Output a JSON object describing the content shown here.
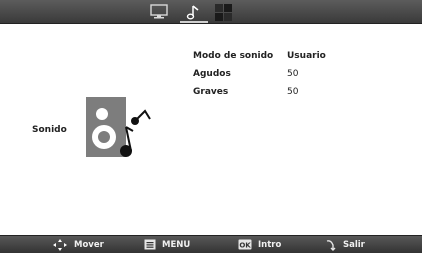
{
  "topbar": {
    "tabs": [
      {
        "icon": "tv-icon"
      },
      {
        "icon": "music-note-icon"
      },
      {
        "icon": "settings-grid-icon"
      }
    ],
    "active_tab": 1
  },
  "section": {
    "label": "Sonido",
    "icon": "speaker-icon"
  },
  "settings": [
    {
      "label": "Modo de sonido",
      "value": "Usuario"
    },
    {
      "label": "Agudos",
      "value": "50"
    },
    {
      "label": "Graves",
      "value": "50"
    }
  ],
  "bottombar": {
    "move_label": "Mover",
    "menu_label": "MENU",
    "enter_label": "Intro",
    "exit_label": "Salir",
    "ok_badge": "OK"
  }
}
